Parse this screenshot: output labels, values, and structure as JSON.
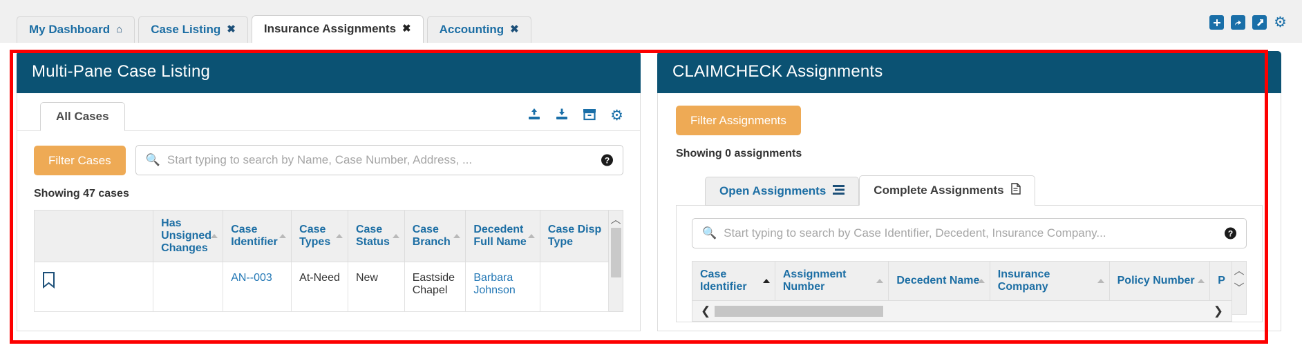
{
  "browser_tabs": [
    {
      "label": "My Dashboard",
      "icon": "home-icon",
      "active": false,
      "closable": false
    },
    {
      "label": "Case Listing",
      "icon": "close-icon",
      "active": false,
      "closable": true
    },
    {
      "label": "Insurance Assignments",
      "icon": "close-icon",
      "active": true,
      "closable": true
    },
    {
      "label": "Accounting",
      "icon": "close-icon",
      "active": false,
      "closable": true
    }
  ],
  "top_icons": [
    {
      "name": "add-icon",
      "glyph": "✚"
    },
    {
      "name": "share-icon",
      "glyph": "↪"
    },
    {
      "name": "external-link-icon",
      "glyph": "↗"
    },
    {
      "name": "settings-gear-icon",
      "glyph": "⚙"
    }
  ],
  "colors": {
    "panel_header": "#0b5273",
    "accent_orange": "#eeaa55",
    "link_blue": "#1c6ea4",
    "highlight_border": "#fd0000"
  },
  "left_pane": {
    "title": "Multi-Pane Case Listing",
    "tab_label": "All Cases",
    "toolbar_icons": [
      {
        "name": "upload-icon",
        "glyph": "⬆"
      },
      {
        "name": "download-icon",
        "glyph": "⬇"
      },
      {
        "name": "archive-icon",
        "glyph": "▤"
      },
      {
        "name": "gear-icon",
        "glyph": "⚙"
      }
    ],
    "filter_button": "Filter Cases",
    "search_placeholder": "Start typing to search by Name, Case Number, Address, ...",
    "search_value": "",
    "help_glyph": "?",
    "showing_text": "Showing 47 cases",
    "columns": [
      {
        "label": "",
        "sortable": false,
        "active_sort": false
      },
      {
        "label": "Has Unsigned Changes",
        "sortable": true,
        "active_sort": false
      },
      {
        "label": "Case Identifier",
        "sortable": true,
        "active_sort": false
      },
      {
        "label": "Case Types",
        "sortable": true,
        "active_sort": false
      },
      {
        "label": "Case Status",
        "sortable": true,
        "active_sort": false
      },
      {
        "label": "Case Branch",
        "sortable": true,
        "active_sort": false
      },
      {
        "label": "Decedent Full Name",
        "sortable": true,
        "active_sort": false
      },
      {
        "label": "Case Disp Type",
        "sortable": false,
        "active_sort": false
      }
    ],
    "rows": [
      {
        "bookmark": "⛉",
        "has_unsigned_changes": "",
        "case_identifier": "AN--003",
        "case_types": "At-Need",
        "case_status": "New",
        "case_branch": "Eastside Chapel",
        "decedent_full_name": "Barbara Johnson",
        "case_disp_type": ""
      }
    ]
  },
  "right_pane": {
    "title": "CLAIMCHECK Assignments",
    "filter_button": "Filter Assignments",
    "showing_text": "Showing 0 assignments",
    "tabs": [
      {
        "label": "Open Assignments",
        "icon": "list-icon",
        "glyph": "▤",
        "active": false
      },
      {
        "label": "Complete Assignments",
        "icon": "document-icon",
        "glyph": "🗋",
        "active": true
      }
    ],
    "search_placeholder": "Start typing to search by Case Identifier, Decedent, Insurance Company...",
    "search_value": "",
    "help_glyph": "?",
    "columns": [
      {
        "label": "Case Identifier",
        "sortable": true,
        "active_sort": true
      },
      {
        "label": "Assignment Number",
        "sortable": true,
        "active_sort": false
      },
      {
        "label": "Decedent Name",
        "sortable": true,
        "active_sort": false
      },
      {
        "label": "Insurance Company",
        "sortable": true,
        "active_sort": false
      },
      {
        "label": "Policy Number",
        "sortable": true,
        "active_sort": false
      },
      {
        "label": "P",
        "sortable": false,
        "active_sort": false
      }
    ],
    "rows": [],
    "hscroll": {
      "left_arrow": "❮",
      "right_arrow": "❯"
    }
  }
}
